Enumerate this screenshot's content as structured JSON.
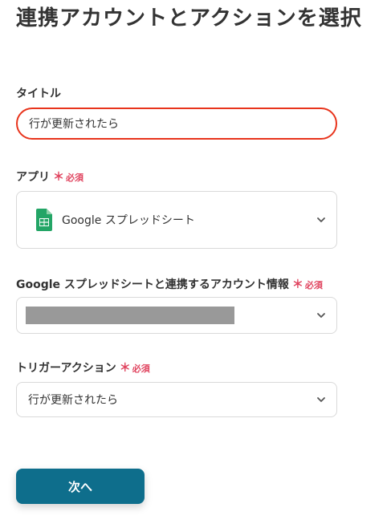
{
  "page_title": "連携アカウントとアクションを選択",
  "title_field": {
    "label": "タイトル",
    "value": "行が更新されたら"
  },
  "app_field": {
    "label": "アプリ",
    "required_mark": "＊",
    "required_text": "必須",
    "selected_app": "Google スプレッドシート",
    "app_icon": "google-sheets-icon"
  },
  "account_field": {
    "label": "Google スプレッドシートと連携するアカウント情報",
    "required_mark": "＊",
    "required_text": "必須",
    "value_masked": true
  },
  "trigger_field": {
    "label": "トリガーアクション",
    "required_mark": "＊",
    "required_text": "必須",
    "selected": "行が更新されたら"
  },
  "next_button": {
    "label": "次へ"
  },
  "colors": {
    "required": "#e0445f",
    "highlight": "#e8341c",
    "primary_button": "#0e6e8c",
    "sheets_green": "#23a566"
  }
}
